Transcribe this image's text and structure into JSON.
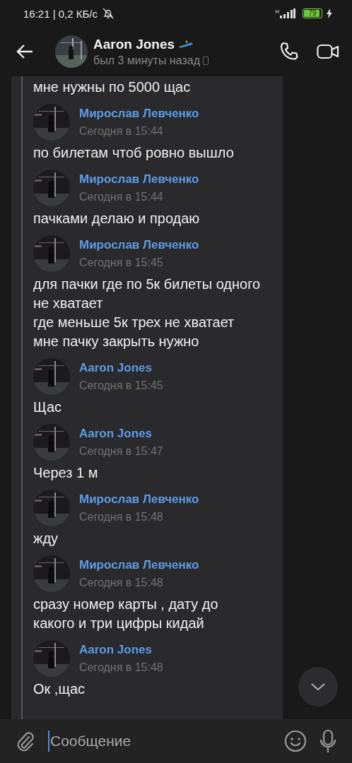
{
  "status_bar": {
    "time": "16:21 | 0,2 КБ/с",
    "network": "H",
    "battery": "79",
    "charging": true
  },
  "header": {
    "name": "Aaron Jones",
    "status": "был 3 минуты назад"
  },
  "leading_text": "мне нужны по 5000 щас",
  "messages": [
    {
      "sender": "Мирослав Левченко",
      "time": "Сегодня в 15:44",
      "lines": [
        "по билетам чтоб ровно вышло"
      ]
    },
    {
      "sender": "Мирослав Левченко",
      "time": "Сегодня в 15:44",
      "lines": [
        "пачками делаю и продаю"
      ]
    },
    {
      "sender": "Мирослав Левченко",
      "time": "Сегодня в 15:45",
      "lines": [
        "для пачки где по 5к билеты одного",
        "не хватает",
        "где меньше 5к трех не хватает",
        "мне пачку закрыть нужно"
      ]
    },
    {
      "sender": "Aaron Jones",
      "time": "Сегодня в 15:45",
      "lines": [
        "Щас"
      ]
    },
    {
      "sender": "Aaron Jones",
      "time": "Сегодня в 15:47",
      "lines": [
        "Через 1 м"
      ]
    },
    {
      "sender": "Мирослав Левченко",
      "time": "Сегодня в 15:48",
      "lines": [
        "жду"
      ]
    },
    {
      "sender": "Мирослав Левченко",
      "time": "Сегодня в 15:48",
      "lines": [
        "сразу номер карты , дату до",
        "какого и три цифры кидай"
      ]
    },
    {
      "sender": "Aaron Jones",
      "time": "Сегодня в 15:48",
      "lines": [
        "Ок ,щас"
      ]
    }
  ],
  "composer": {
    "placeholder": "Сообщение"
  }
}
